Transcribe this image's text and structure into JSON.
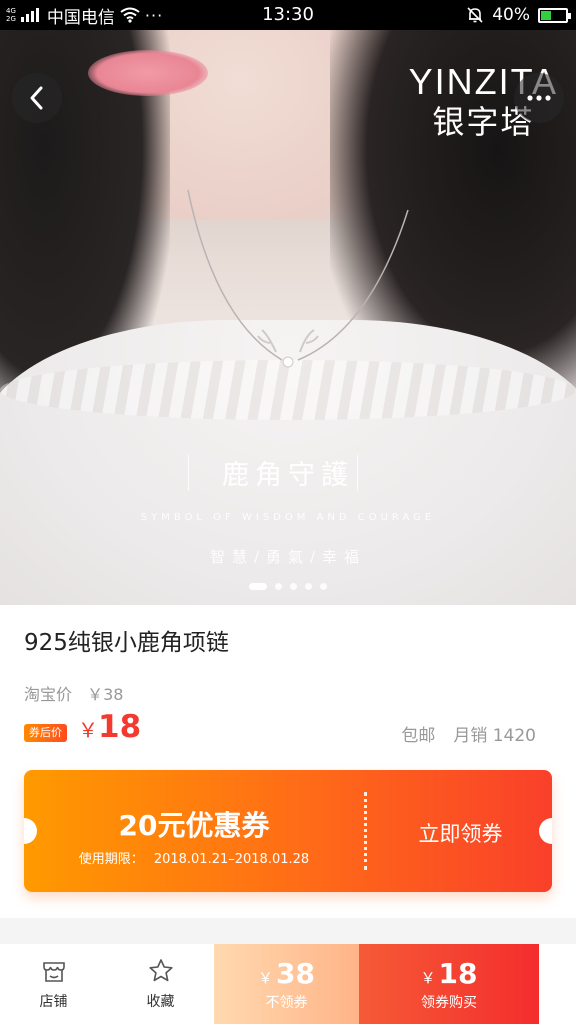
{
  "status_bar": {
    "network_top": "4G",
    "network_bottom": "2G",
    "carrier": "中国电信",
    "more": "···",
    "time": "13:30",
    "battery": "40%",
    "battery_level": 0.4,
    "icons": [
      "signal-icon",
      "wifi-icon",
      "mute-bell-icon",
      "battery-icon"
    ]
  },
  "hero": {
    "brand_en": "YINZITA",
    "brand_cn": "银字塔",
    "tagline_cn": "鹿角守護",
    "tagline_en": "SYMBOL OF WISDOM AND COURAGE",
    "tagline_sub": "智慧/勇氣/幸福",
    "slide_count": 5,
    "active_slide": 1
  },
  "product": {
    "title": "925纯银小鹿角项链",
    "taobao_price_label": "淘宝价",
    "taobao_price": "￥38",
    "after_coupon_label": "券后价",
    "currency": "￥",
    "after_coupon_price": "18",
    "shipping": "包邮",
    "monthly_sales": "月销 1420"
  },
  "coupon": {
    "amount": "20元优惠券",
    "validity_label": "使用期限：",
    "validity": "2018.01.21–2018.01.28",
    "cta": "立即领券"
  },
  "bottom_bar": {
    "shop": "店铺",
    "favorite": "收藏",
    "no_coupon_currency": "￥",
    "no_coupon_price": "38",
    "no_coupon_label": "不领券",
    "buy_currency": "￥",
    "buy_price": "18",
    "buy_label": "领券购买"
  },
  "colors": {
    "accent_red": "#f43a2e",
    "coupon_start": "#ff9a00",
    "coupon_end": "#f9402a"
  }
}
